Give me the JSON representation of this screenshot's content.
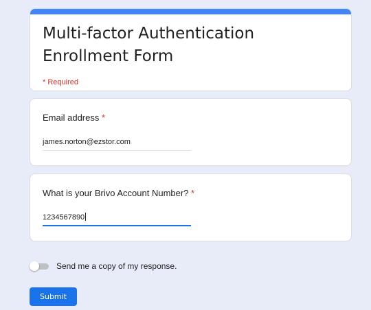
{
  "form": {
    "title": "Multi-factor Authentication Enrollment Form",
    "required_note": "* Required"
  },
  "questions": [
    {
      "label": "Email address",
      "required_marker": "*",
      "value": "james.norton@ezstor.com"
    },
    {
      "label": "What is your Brivo Account Number?",
      "required_marker": "*",
      "value": "1234567890"
    }
  ],
  "copy_toggle": {
    "label": "Send me a copy of my response.",
    "checked": false
  },
  "submit": {
    "label": "Submit"
  },
  "colors": {
    "accent": "#4285f4",
    "button": "#1a73e8",
    "required": "#d93025",
    "background": "#e8ecf8"
  }
}
